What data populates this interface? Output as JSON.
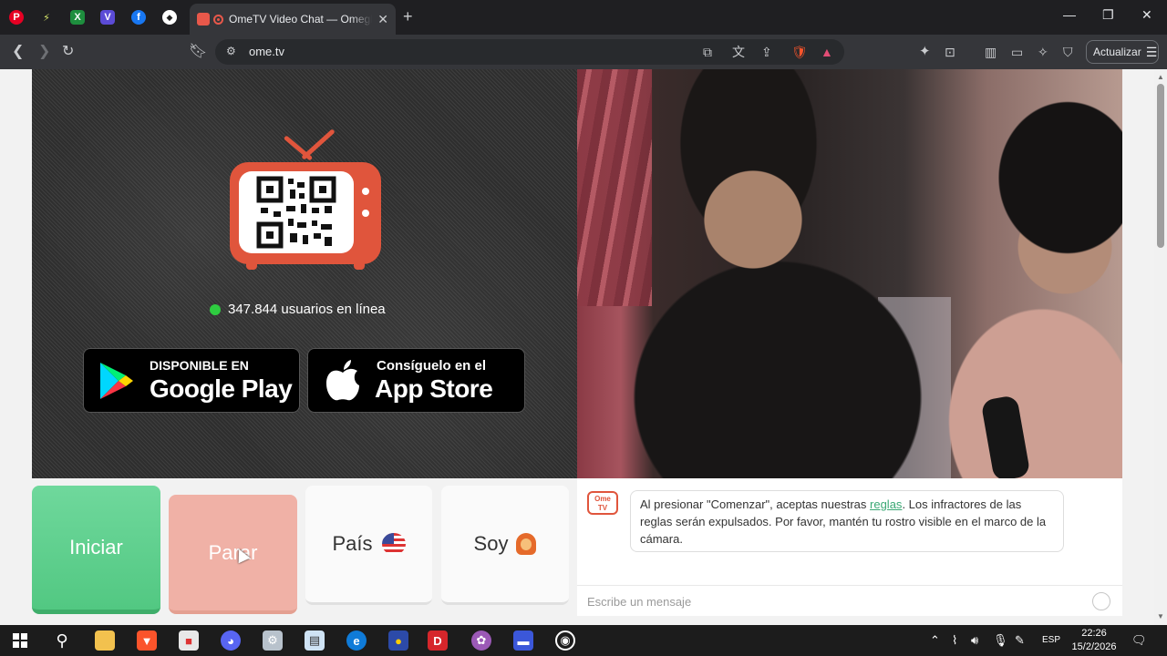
{
  "browser": {
    "pinned_tabs": [
      {
        "name": "pinterest",
        "letter": "P",
        "color": "#e60023"
      },
      {
        "name": "bolt",
        "letter": "⚡",
        "color": "#3d3d3d"
      },
      {
        "name": "sheets",
        "letter": "X",
        "color": "#1e8e3e"
      },
      {
        "name": "vpn",
        "letter": "V",
        "color": "#5b4bd6"
      },
      {
        "name": "facebook",
        "letter": "f",
        "color": "#1877f2"
      },
      {
        "name": "diamond",
        "letter": "◆",
        "color": "#3d3d3d"
      }
    ],
    "active_tab_title": "OmeTV Video Chat — Omegle",
    "close_glyph": "✕",
    "new_tab_glyph": "+",
    "url": "ome.tv",
    "update_label": "Actualizar"
  },
  "page": {
    "online_count_text": "347.844 usuarios en línea",
    "google_play": {
      "line1": "DISPONIBLE EN",
      "line2": "Google Play"
    },
    "app_store": {
      "line1": "Consíguelo en el",
      "line2": "App Store"
    },
    "controls": {
      "start": "Iniciar",
      "stop": "Parar",
      "country": "País",
      "gender": "Soy"
    },
    "chat": {
      "avatar_text": "Ome TV",
      "message_prefix": "Al presionar \"Comenzar\", aceptas nuestras ",
      "message_link": "reglas",
      "message_suffix": ". Los infractores de las reglas serán expulsados. Por favor, mantén tu rostro visible en el marco de la cámara.",
      "placeholder": "Escribe un mensaje"
    },
    "colors": {
      "brand_red": "#e0553c",
      "start_green": "#52c882",
      "stop_salmon": "#f0b1a6",
      "online_green": "#2ecc40"
    }
  },
  "taskbar": {
    "language": "ESP",
    "time": "22:26",
    "date": "15/2/2026"
  }
}
